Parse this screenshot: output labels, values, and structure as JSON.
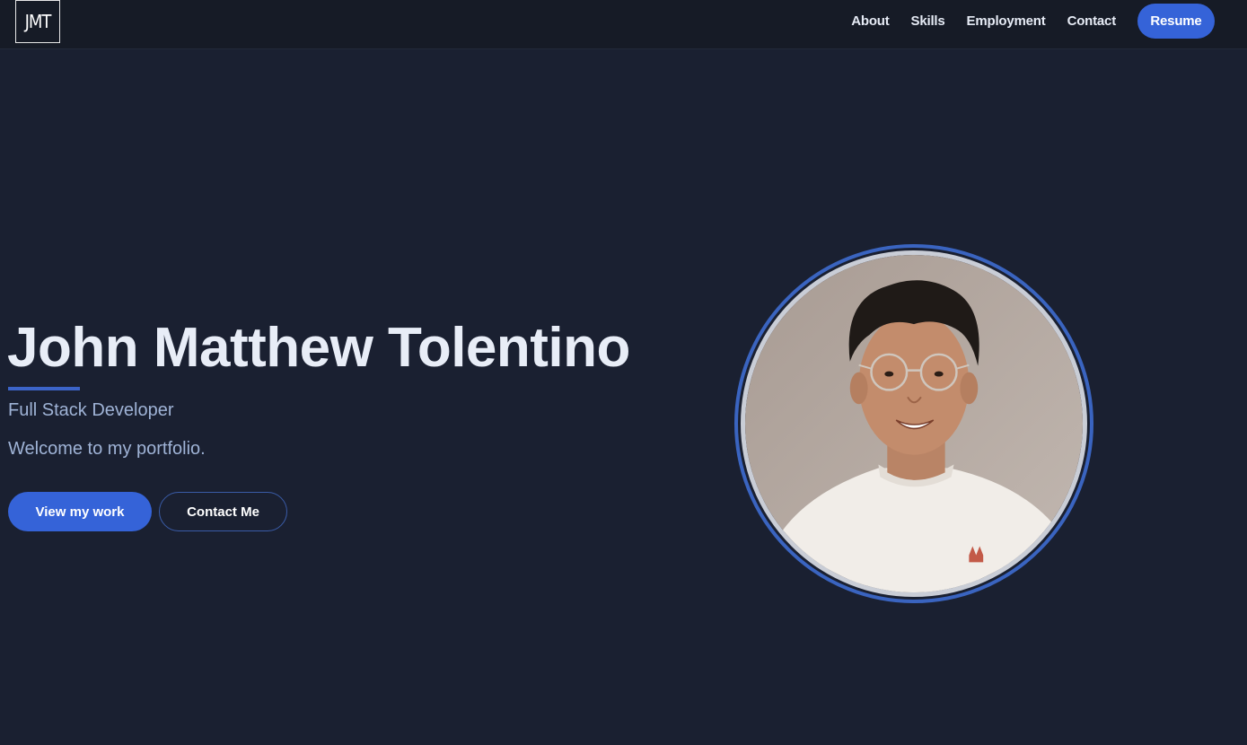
{
  "nav": {
    "logo": "JMT",
    "links": [
      "About",
      "Skills",
      "Employment",
      "Contact"
    ],
    "resume_label": "Resume"
  },
  "hero": {
    "name": "John Matthew Tolentino",
    "role": "Full Stack Developer",
    "welcome": "Welcome to my portfolio.",
    "primary_button": "View my work",
    "secondary_button": "Contact Me"
  },
  "colors": {
    "background": "#1a2031",
    "navbar": "#161b26",
    "accent": "#3563d8",
    "text": "#e8edf7",
    "muted_text": "#9fb3d6"
  },
  "icons": {
    "profile_photo": "profile-photo"
  }
}
